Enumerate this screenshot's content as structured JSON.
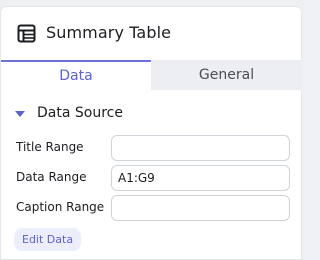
{
  "header": {
    "title": "Summary Table",
    "icon": "table-icon"
  },
  "tabs": [
    {
      "label": "Data",
      "active": true
    },
    {
      "label": "General",
      "active": false
    }
  ],
  "section": {
    "title": "Data Source",
    "expanded": true
  },
  "fields": {
    "title_range": {
      "label": "Title Range",
      "value": ""
    },
    "data_range": {
      "label": "Data Range",
      "value": "A1:G9"
    },
    "caption_range": {
      "label": "Caption Range",
      "value": ""
    }
  },
  "actions": {
    "edit_data_label": "Edit Data"
  },
  "colors": {
    "accent": "#5b63d3",
    "panel_bg": "#ffffff",
    "inactive_tab_bg": "#eceef1"
  }
}
